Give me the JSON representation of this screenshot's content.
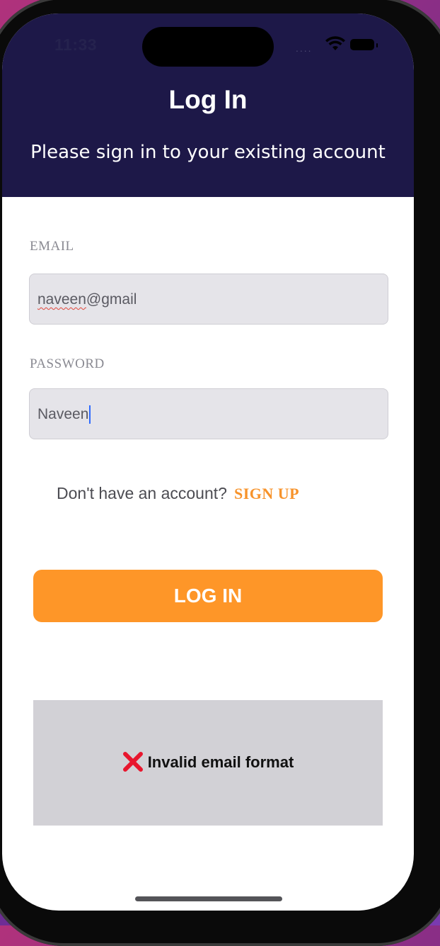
{
  "status_bar": {
    "time": "11:33",
    "signal": "...."
  },
  "header": {
    "title": "Log In",
    "subtitle": "Please sign in to your existing account"
  },
  "form": {
    "email": {
      "label": "EMAIL",
      "value_misspelled_part": "naveen",
      "value_rest": "@gmail"
    },
    "password": {
      "label": "PASSWORD",
      "value": "Naveen"
    },
    "signup_prompt": "Don't have an account?",
    "signup_link": "SIGN UP",
    "login_button": "LOG IN"
  },
  "toast": {
    "icon": "x-icon",
    "message": "Invalid email format"
  },
  "colors": {
    "header_bg": "#1d1848",
    "accent": "#fe9628",
    "input_bg": "#e5e4e9",
    "error": "#e8162e",
    "toast_bg": "#d2d1d6"
  }
}
